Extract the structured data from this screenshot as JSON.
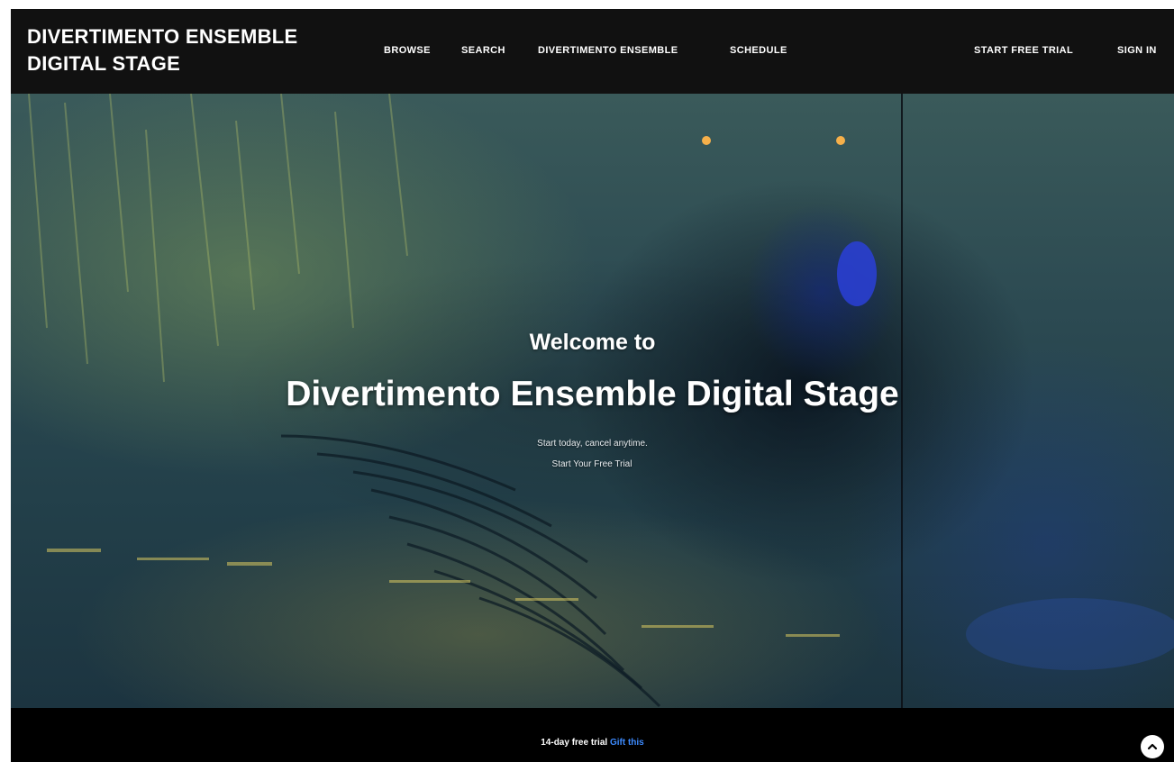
{
  "brand": {
    "line1": "DIVERTIMENTO ENSEMBLE",
    "line2": "DIGITAL STAGE"
  },
  "nav": {
    "browse": "BROWSE",
    "search": "SEARCH",
    "divertimento": "DIVERTIMENTO ENSEMBLE",
    "schedule": "SCHEDULE",
    "start_trial": "START FREE TRIAL",
    "sign_in": "SIGN IN"
  },
  "hero": {
    "welcome": "Welcome to",
    "title": "Divertimento Ensemble Digital Stage",
    "subtitle": "Start today, cancel anytime.",
    "cta": "Start Your Free Trial"
  },
  "footer": {
    "trial_text": "14-day free trial",
    "gift_link": "Gift this"
  },
  "colors": {
    "nav_bg": "#111111",
    "footer_bg": "#000000",
    "link_accent": "#3d8bff",
    "text": "#ffffff"
  },
  "icons": {
    "scroll_top": "chevron-up-icon"
  }
}
